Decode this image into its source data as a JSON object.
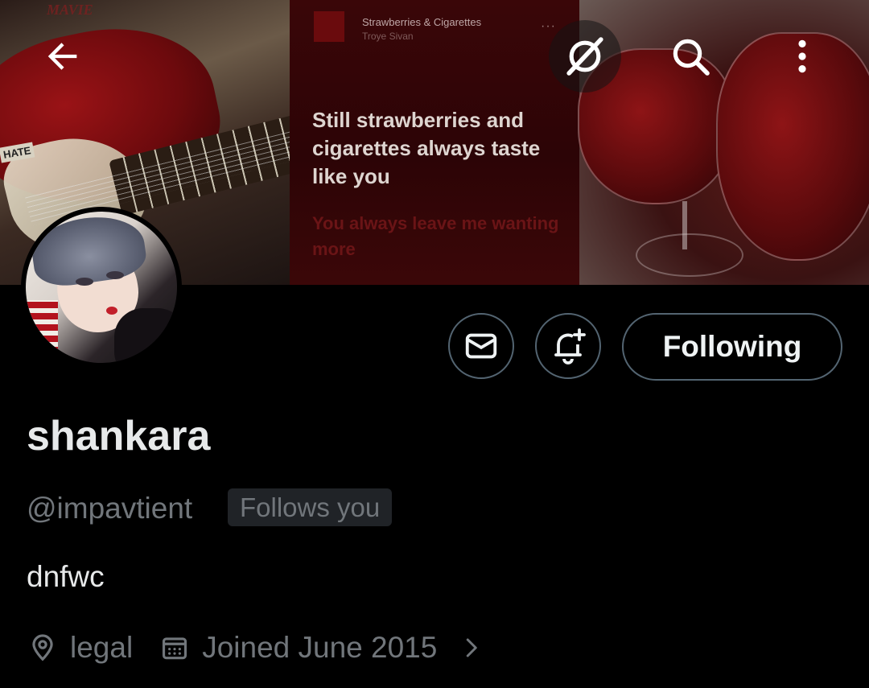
{
  "banner": {
    "sticker_text": "HATE",
    "tag_text": "MAVIE",
    "song": {
      "title": "Strawberries & Cigarettes",
      "artist": "Troye Sivan",
      "menu": "···"
    },
    "lyric_main": "Still strawberries and cigarettes always taste like you",
    "lyric_next": "You always leave me wanting more"
  },
  "topbar": {
    "icons": [
      "back-arrow-icon",
      "grok-icon",
      "search-icon",
      "more-vertical-icon"
    ]
  },
  "profile": {
    "display_name": "shankara",
    "handle": "@impavtient",
    "follows_you": "Follows you",
    "bio": "dnfwc",
    "location": "legal",
    "joined": "Joined June 2015"
  },
  "actions": {
    "following_label": "Following",
    "message_icon": "envelope-icon",
    "notify_icon": "bell-plus-icon"
  },
  "colors": {
    "background": "#000000",
    "primary_text": "#e7e9ea",
    "secondary_text": "#71767b",
    "border": "#536471",
    "badge_bg": "#202327"
  }
}
